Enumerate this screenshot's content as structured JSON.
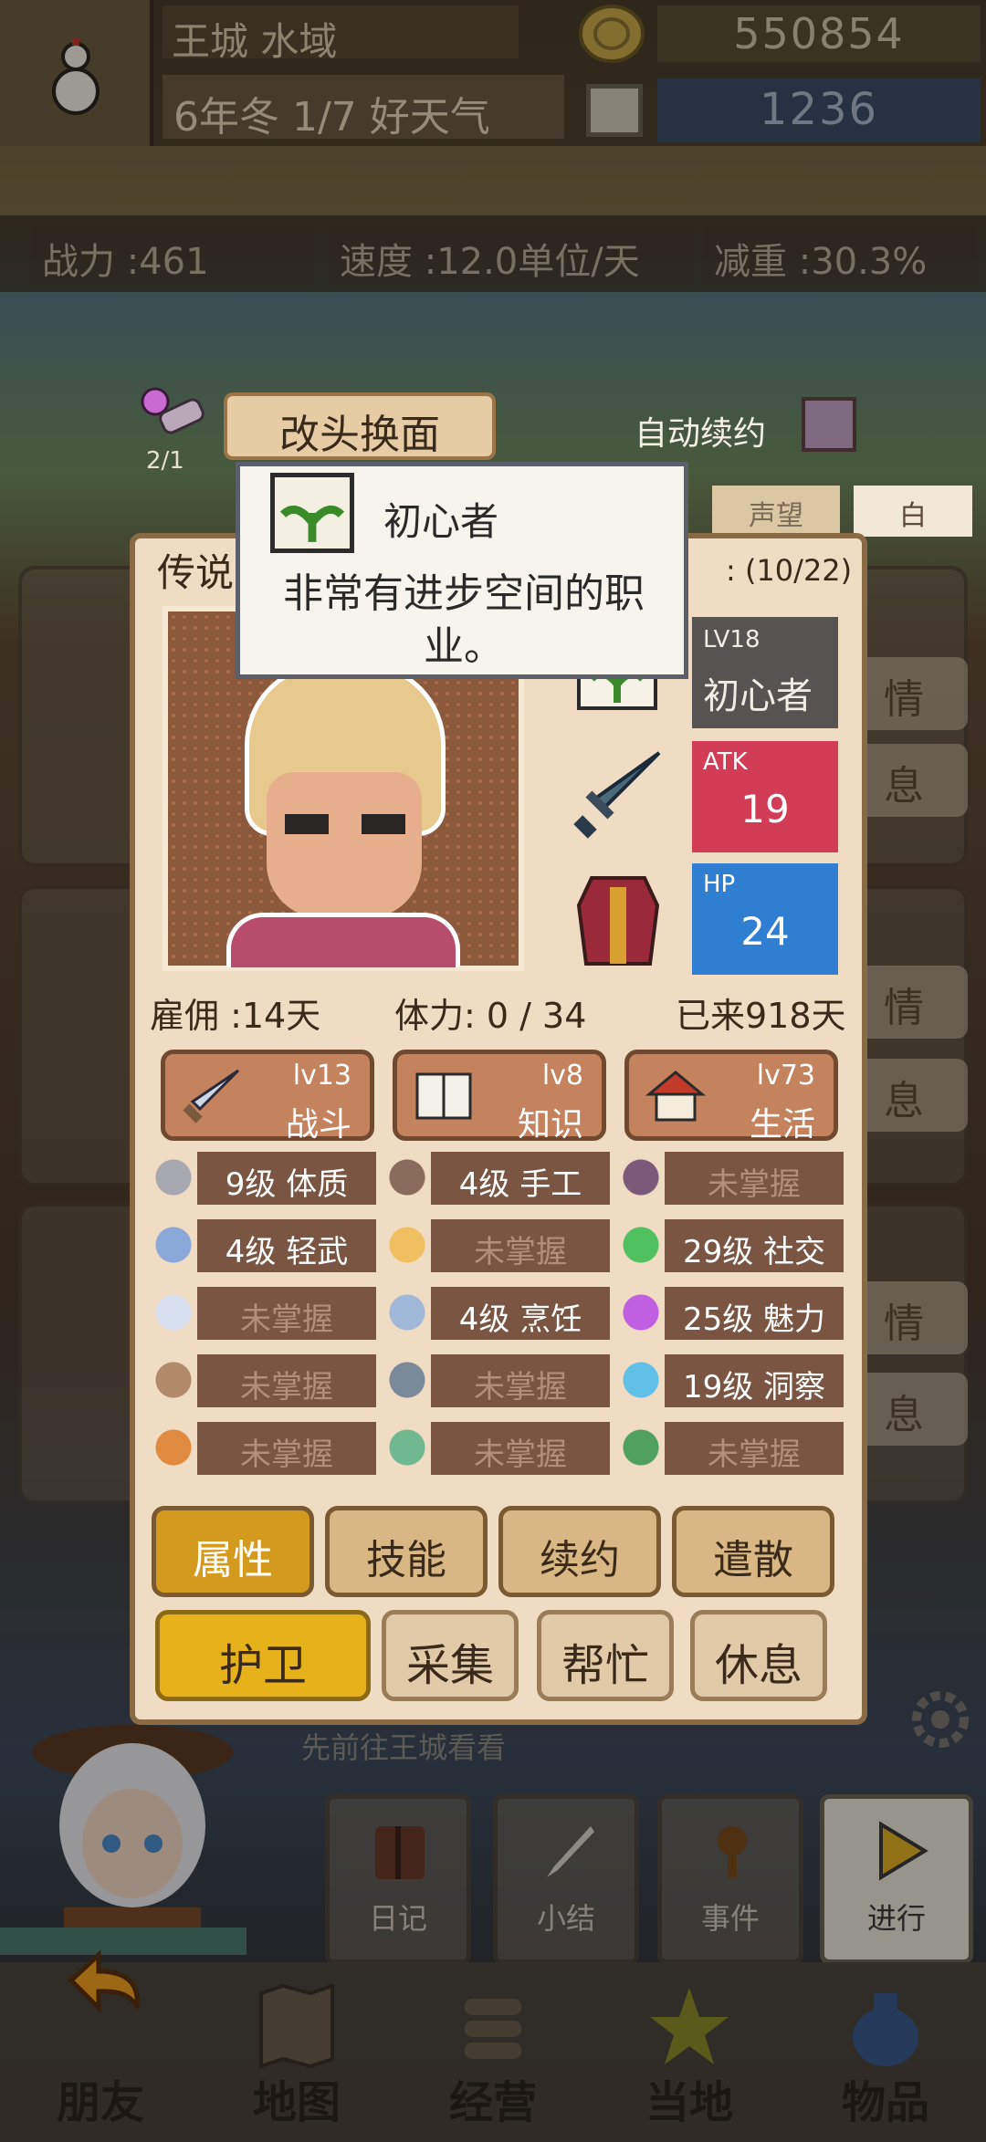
{
  "header": {
    "location": "王城 水域",
    "date": "6年冬 1/7 好天气",
    "gold": "550854",
    "gems": "1236"
  },
  "stats": {
    "power": "战力 :461",
    "speed": "速度 :12.0单位/天",
    "weight": "减重 :30.3%"
  },
  "strip": {
    "bag_count": "2/1",
    "change_look": "改头换面",
    "auto_renew": "自动续约",
    "side_tab_1": "声望",
    "side_tab_2": "白"
  },
  "panel": {
    "label": "传说",
    "count": ": (10/22)",
    "level": "LV18",
    "job": "初心者",
    "atk_label": "ATK",
    "atk": "19",
    "hp_label": "HP",
    "hp": "24",
    "hire": "雇佣 :14天",
    "stamina": "体力: 0 / 34",
    "days": "已来918天"
  },
  "skill_categories": [
    {
      "lv": "lv13",
      "name": "战斗",
      "icon": "sword-icon"
    },
    {
      "lv": "lv8",
      "name": "知识",
      "icon": "book-icon"
    },
    {
      "lv": "lv73",
      "name": "生活",
      "icon": "house-icon"
    }
  ],
  "skills": [
    {
      "text": "9级 体质",
      "icon": "armor-arm-icon",
      "learned": true
    },
    {
      "text": "4级 手工",
      "icon": "brush-icon",
      "learned": true
    },
    {
      "text": "未掌握",
      "icon": "lightning-icon",
      "learned": false
    },
    {
      "text": "4级 轻武",
      "icon": "dagger-icon",
      "learned": true
    },
    {
      "text": "未掌握",
      "icon": "potion-icon",
      "learned": false
    },
    {
      "text": "29级 社交",
      "icon": "chat-icon",
      "learned": true
    },
    {
      "text": "未掌握",
      "icon": "feather-icon",
      "learned": false
    },
    {
      "text": "4级 烹饪",
      "icon": "pot-icon",
      "learned": true
    },
    {
      "text": "25级 魅力",
      "icon": "sparkle-icon",
      "learned": true
    },
    {
      "text": "未掌握",
      "icon": "bow-icon",
      "learned": false
    },
    {
      "text": "未掌握",
      "icon": "hammer-icon",
      "learned": false
    },
    {
      "text": "19级 洞察",
      "icon": "eye-icon",
      "learned": true
    },
    {
      "text": "未掌握",
      "icon": "wand-icon",
      "learned": false
    },
    {
      "text": "未掌握",
      "icon": "orb-icon",
      "learned": false
    },
    {
      "text": "未掌握",
      "icon": "clover-icon",
      "learned": false
    }
  ],
  "tabs": [
    "属性",
    "技能",
    "续约",
    "遣散"
  ],
  "actions": [
    "护卫",
    "采集",
    "帮忙",
    "休息"
  ],
  "tooltip": {
    "title": "初心者",
    "desc": "非常有进步空间的职业。"
  },
  "background": {
    "hint": "先前往王城看看",
    "card_btn_a": "情",
    "card_btn_b": "息"
  },
  "mid_buttons": [
    "日记",
    "小结",
    "事件",
    "进行"
  ],
  "nav": [
    "朋友",
    "地图",
    "经营",
    "当地",
    "物品"
  ],
  "colors": {
    "panel_bg": "#f0dcc3",
    "atk": "#d23c55",
    "hp": "#2f7ed2",
    "active_tab": "#d39a1e",
    "primary_action": "#e6b11a"
  }
}
